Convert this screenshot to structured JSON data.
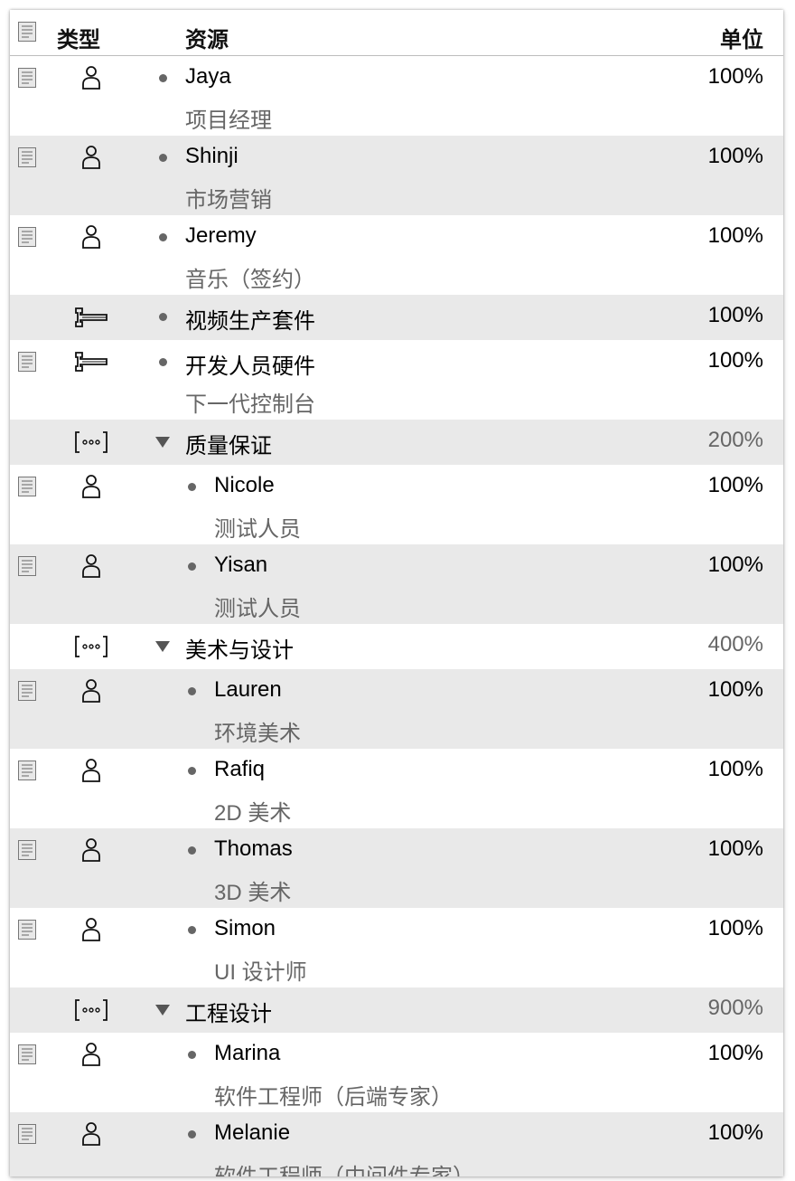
{
  "header": {
    "type": "类型",
    "resource": "资源",
    "unit": "单位"
  },
  "rows": [
    {
      "kind": "person",
      "name": "Jaya",
      "sub": "项目经理",
      "unit": "100%"
    },
    {
      "kind": "person",
      "name": "Shinji",
      "sub": "市场营销",
      "unit": "100%"
    },
    {
      "kind": "person",
      "name": "Jeremy",
      "sub": "音乐（签约）",
      "unit": "100%"
    },
    {
      "kind": "equipment",
      "name": "视频生产套件",
      "sub": "",
      "unit": "100%"
    },
    {
      "kind": "equipment",
      "name": "开发人员硬件",
      "sub": "下一代控制台",
      "unit": "100%"
    },
    {
      "kind": "group",
      "name": "质量保证",
      "sub": "",
      "unit": "200%"
    },
    {
      "kind": "person",
      "name": "Nicole",
      "sub": "测试人员",
      "unit": "100%"
    },
    {
      "kind": "person",
      "name": "Yisan",
      "sub": "测试人员",
      "unit": "100%"
    },
    {
      "kind": "group",
      "name": "美术与设计",
      "sub": "",
      "unit": "400%"
    },
    {
      "kind": "person",
      "name": "Lauren",
      "sub": "环境美术",
      "unit": "100%"
    },
    {
      "kind": "person",
      "name": "Rafiq",
      "sub": "2D 美术",
      "unit": "100%"
    },
    {
      "kind": "person",
      "name": "Thomas",
      "sub": "3D 美术",
      "unit": "100%"
    },
    {
      "kind": "person",
      "name": "Simon",
      "sub": "UI 设计师",
      "unit": "100%"
    },
    {
      "kind": "group",
      "name": "工程设计",
      "sub": "",
      "unit": "900%"
    },
    {
      "kind": "person",
      "name": "Marina",
      "sub": "软件工程师（后端专家）",
      "unit": "100%"
    },
    {
      "kind": "person",
      "name": "Melanie",
      "sub": "软件工程师（中间件专家）",
      "unit": "100%"
    }
  ]
}
